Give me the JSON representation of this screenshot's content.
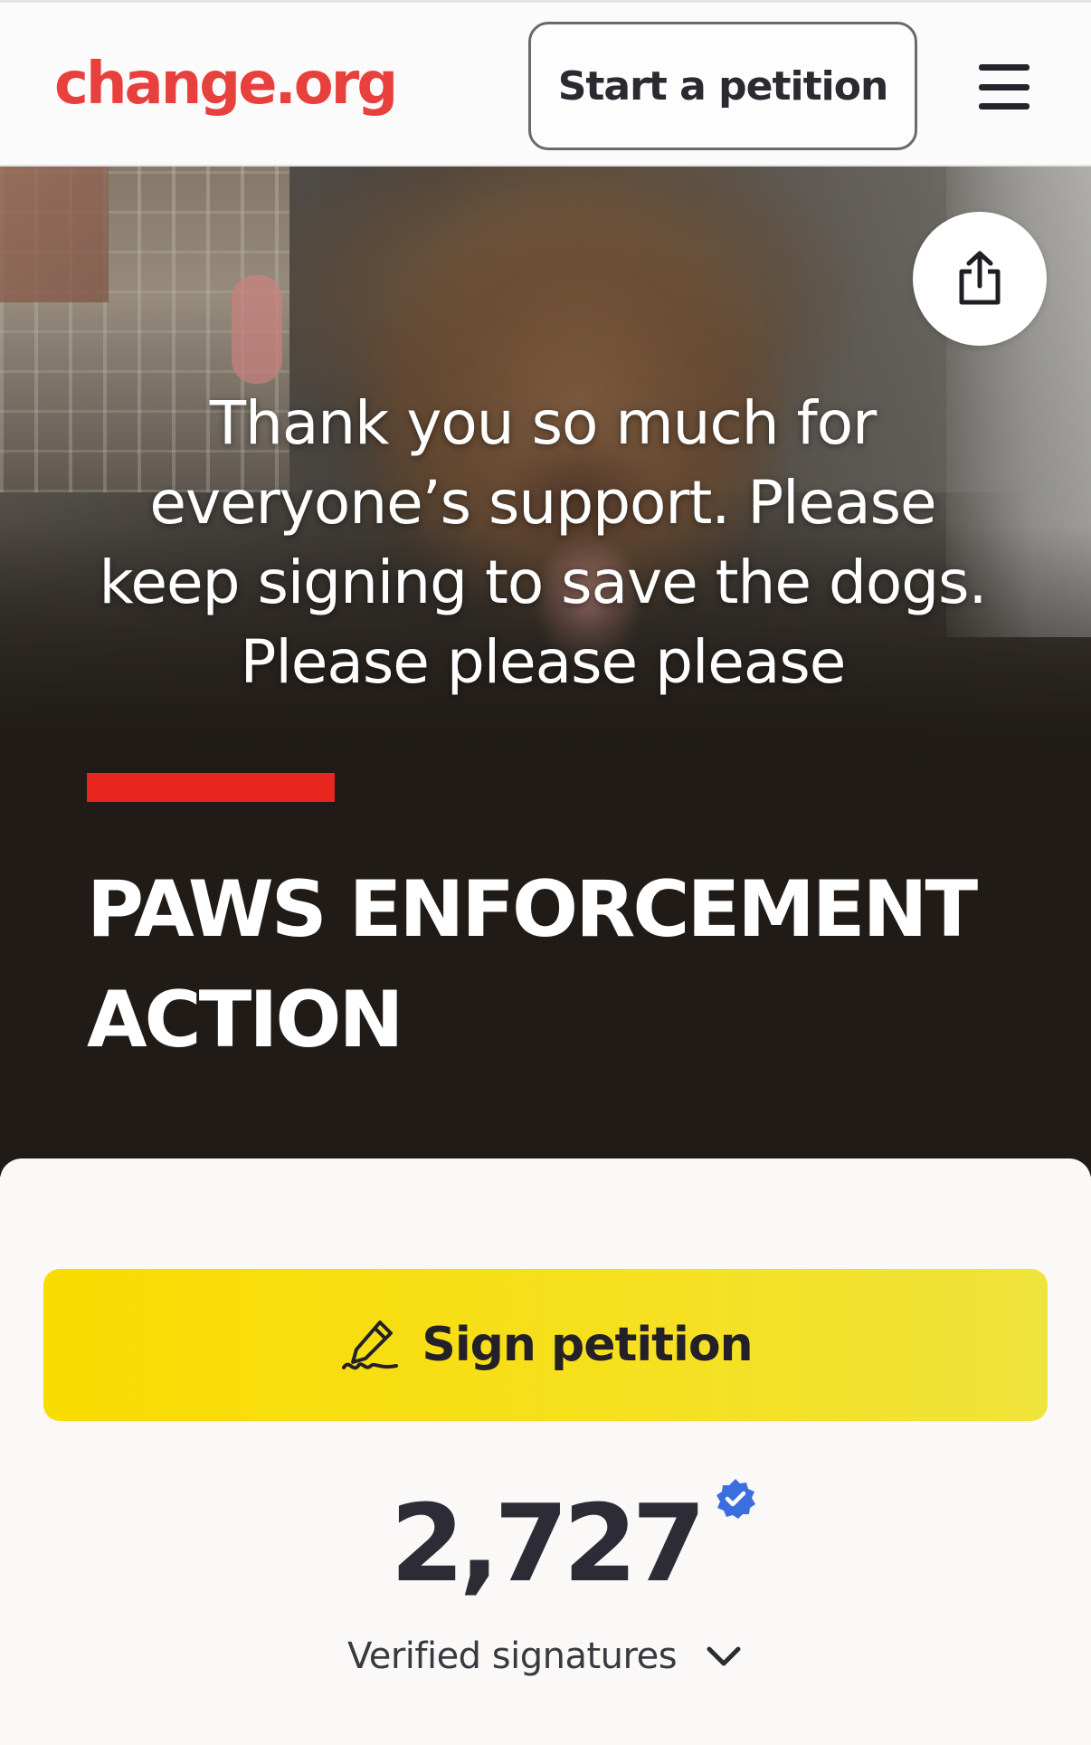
{
  "header": {
    "logo_text": "change.org",
    "start_petition_label": "Start a petition",
    "menu_icon": "hamburger-menu-icon"
  },
  "hero": {
    "photo_caption": "Thank you so much for everyone’s support. Please keep signing to save the dogs. Please please please",
    "share_icon": "share-icon",
    "title_line1": "PAWS ENFORCEMENT",
    "title_line2": "ACTION"
  },
  "card": {
    "sign_label": "Sign petition",
    "sign_icon": "pen-signature-icon",
    "signature_count": "2,727",
    "verified_icon": "verified-badge-icon",
    "signatures_label": "Verified signatures",
    "expand_icon": "chevron-down-icon"
  },
  "colors": {
    "brand_red": "#e8403c",
    "accent_bar": "#e7261f",
    "sign_yellow": "#f9dc00",
    "hero_dark": "#201b17",
    "verified_blue": "#3b6fe0"
  }
}
